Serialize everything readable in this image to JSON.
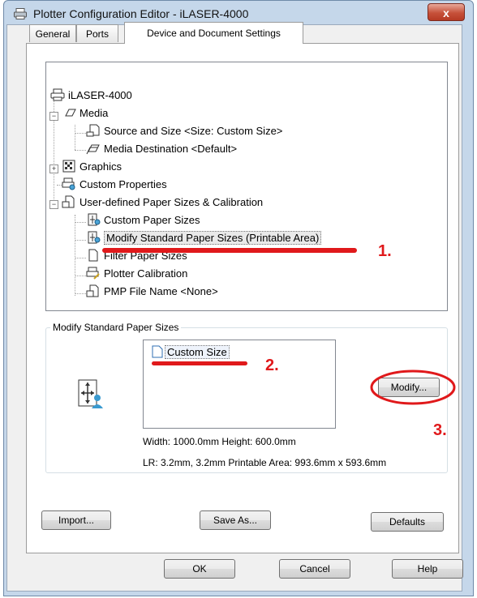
{
  "window": {
    "title": "Plotter Configuration Editor - iLASER-4000",
    "close_label": "x"
  },
  "tabs": [
    {
      "label": "General",
      "active": false
    },
    {
      "label": "Ports",
      "active": false
    },
    {
      "label": "Device and Document Settings",
      "active": true
    }
  ],
  "tree": {
    "root": "iLASER-4000",
    "media": "Media",
    "source_size": "Source and Size <Size: Custom Size>",
    "media_dest": "Media Destination <Default>",
    "graphics": "Graphics",
    "custom_props": "Custom Properties",
    "user_defined": "User-defined Paper Sizes & Calibration",
    "custom_paper": "Custom Paper Sizes",
    "modify_std": "Modify Standard Paper Sizes (Printable Area)",
    "filter_paper": "Filter Paper Sizes",
    "plotter_cal": "Plotter Calibration",
    "pmp_file": "PMP File Name <None>"
  },
  "group": {
    "label": "Modify Standard Paper Sizes",
    "list_item": "Custom Size",
    "modify_label": "Modify...",
    "size_info": "Width: 1000.0mm Height: 600.0mm",
    "area_info": "LR: 3.2mm, 3.2mm  Printable Area: 993.6mm x 593.6mm"
  },
  "buttons": {
    "import": "Import...",
    "save_as": "Save As...",
    "defaults": "Defaults",
    "ok": "OK",
    "cancel": "Cancel",
    "help": "Help"
  },
  "annotations": {
    "step1": "1.",
    "step2": "2.",
    "step3": "3."
  },
  "colors": {
    "annotation": "#e0191b",
    "frame": "#c5d7ea"
  }
}
